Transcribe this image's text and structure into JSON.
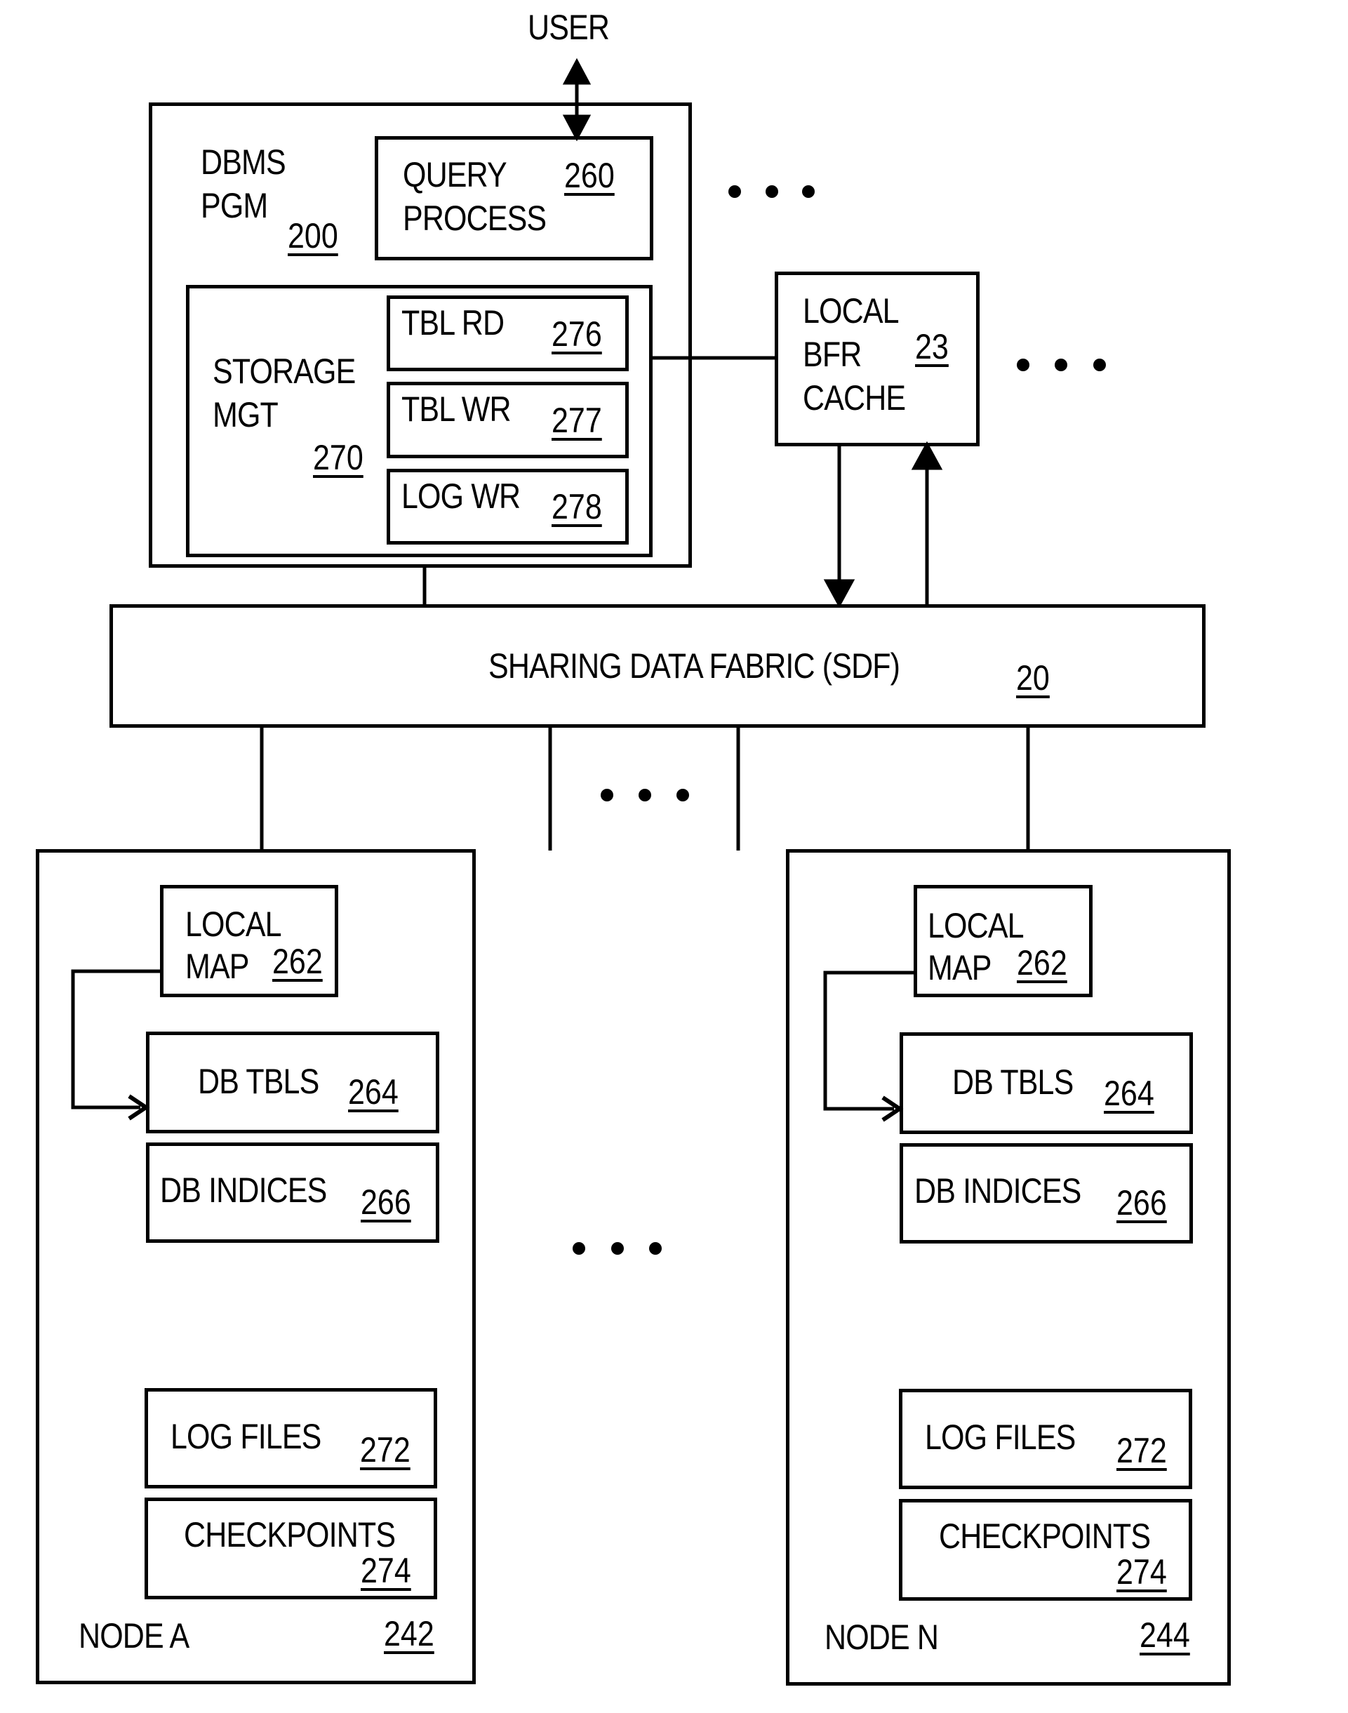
{
  "external": {
    "user_label": "USER"
  },
  "dbms": {
    "label_line1": "DBMS",
    "label_line2": "PGM",
    "ref": "200",
    "query_process": {
      "label_line1": "QUERY",
      "label_line2": "PROCESS",
      "ref": "260"
    },
    "storage_mgt": {
      "label_line1": "STORAGE",
      "label_line2": "MGT",
      "ref": "270",
      "modules": [
        {
          "label": "TBL RD",
          "ref": "276"
        },
        {
          "label": "TBL WR",
          "ref": "277"
        },
        {
          "label": "LOG WR",
          "ref": "278"
        }
      ]
    }
  },
  "local_buffer_cache": {
    "label_line1": "LOCAL",
    "label_line2": "BFR",
    "label_line3": "CACHE",
    "ref": "23"
  },
  "sdf": {
    "label": "SHARING DATA FABRIC (SDF)",
    "ref": "20"
  },
  "nodes": [
    {
      "name": "NODE A",
      "ref": "242",
      "local_map": {
        "label_line1": "LOCAL",
        "label_line2": "MAP",
        "ref": "262"
      },
      "db_tables": {
        "label": "DB TBLS",
        "ref": "264"
      },
      "db_indices": {
        "label": "DB INDICES",
        "ref": "266"
      },
      "log_files": {
        "label": "LOG FILES",
        "ref": "272"
      },
      "checkpoints": {
        "label": "CHECKPOINTS",
        "ref": "274"
      }
    },
    {
      "name": "NODE N",
      "ref": "244",
      "local_map": {
        "label_line1": "LOCAL",
        "label_line2": "MAP",
        "ref": "262"
      },
      "db_tables": {
        "label": "DB TBLS",
        "ref": "264"
      },
      "db_indices": {
        "label": "DB INDICES",
        "ref": "266"
      },
      "log_files": {
        "label": "LOG FILES",
        "ref": "272"
      },
      "checkpoints": {
        "label": "CHECKPOINTS",
        "ref": "274"
      }
    }
  ],
  "ellipsis_marks": [
    "more-dbms-instances",
    "more-caches",
    "more-sdf-links",
    "more-nodes"
  ]
}
